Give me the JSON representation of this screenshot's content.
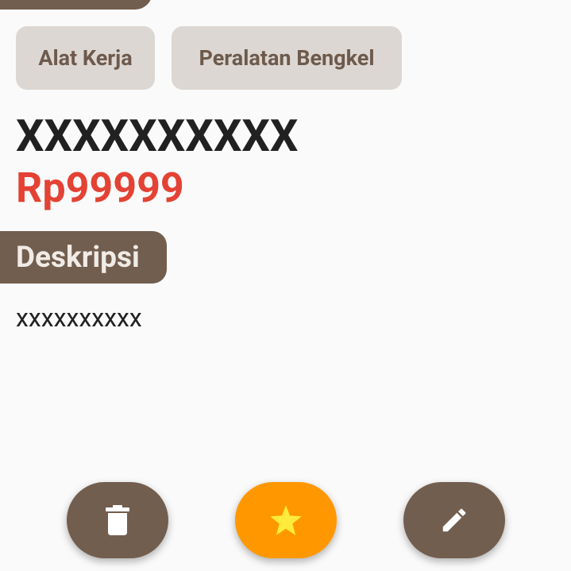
{
  "categories": [
    "Alat Kerja",
    "Peralatan Bengkel"
  ],
  "product": {
    "name": "XXXXXXXXXX",
    "price": "Rp99999"
  },
  "description": {
    "heading": "Deskripsi",
    "text": "xxxxxxxxxx"
  },
  "actions": {
    "delete_icon": "trash-icon",
    "favorite_icon": "star-icon",
    "edit_icon": "pencil-icon"
  },
  "colors": {
    "primary": "#725e4f",
    "chip_bg": "#dcd7d2",
    "price": "#e34234",
    "favorite": "#ff9800",
    "star": "#ffeb3b"
  }
}
